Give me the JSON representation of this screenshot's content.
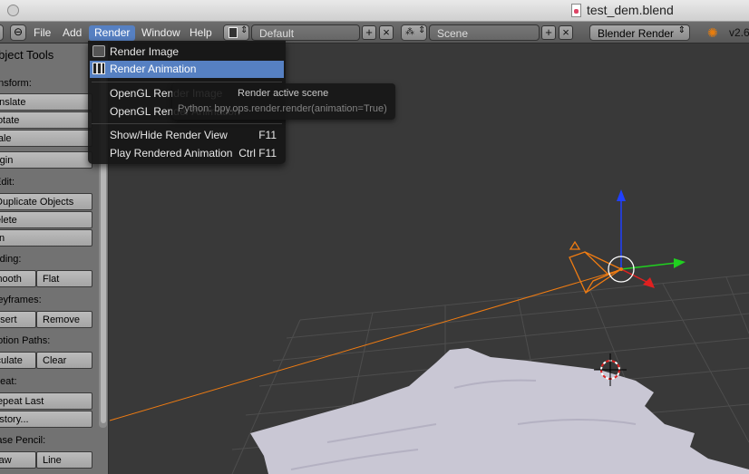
{
  "window": {
    "title": "test_dem.blend"
  },
  "header": {
    "menus": [
      {
        "key": "file",
        "label": "File"
      },
      {
        "key": "add",
        "label": "Add"
      },
      {
        "key": "render",
        "label": "Render"
      },
      {
        "key": "window",
        "label": "Window"
      },
      {
        "key": "help",
        "label": "Help"
      }
    ],
    "screen_layout": "Default",
    "scene": "Scene",
    "engine": "Blender Render",
    "version_text": "v2.6"
  },
  "tool_panel": {
    "title": "Object Tools",
    "sections": {
      "transform": "Transform:",
      "edit": "Edit:",
      "shading": "Shading:",
      "keyframes": "Keyframes:",
      "motion_paths": "Motion Paths:",
      "repeat": "Repeat:",
      "grease_pencil": "Grease Pencil:"
    },
    "buttons": {
      "translate": "Translate",
      "rotate": "Rotate",
      "scale": "Scale",
      "origin": "Origin",
      "duplicate_objects": "Duplicate Objects",
      "delete": "Delete",
      "join": "Join",
      "smooth": "Smooth",
      "flat": "Flat",
      "insert": "Insert",
      "remove": "Remove",
      "calculate": "Calculate",
      "clear": "Clear",
      "repeat_last": "Repeat Last",
      "history": "History...",
      "draw": "Draw",
      "line": "Line"
    }
  },
  "render_menu": {
    "items": {
      "render_image": "Render Image",
      "render_animation": "Render Animation",
      "opengl_render_image": "OpenGL Render Image",
      "opengl_render_animation": "OpenGL Render Animation",
      "show_hide_render_view": "Show/Hide Render View",
      "play_rendered_animation": "Play Rendered Animation"
    },
    "shortcuts": {
      "show_hide_render_view": "F11",
      "play_rendered_animation": "Ctrl F11"
    }
  },
  "tooltip": {
    "title": "Render active scene",
    "python": "Python: bpy.ops.render.render(animation=True)"
  },
  "colors": {
    "menu_highlight": "#5680c2",
    "viewport_bg": "#393939",
    "camera": "#f07c12",
    "axis_x": "#e02020",
    "axis_y": "#20d020",
    "axis_z": "#2040ff",
    "terrain": "#c9c7d4"
  }
}
